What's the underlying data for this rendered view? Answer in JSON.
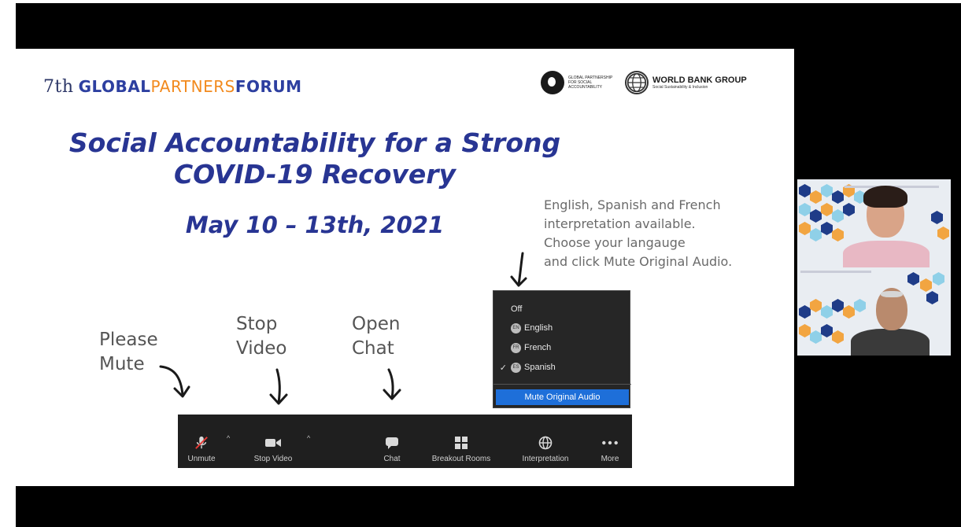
{
  "slide": {
    "forum_logo": {
      "number": "7th",
      "global": "GLOBAL",
      "partners": "PARTNERS",
      "forum": "FORUM"
    },
    "partner_logos": {
      "gpsa_text": "Global Partnership for Social Accountability",
      "wbg_name": "WORLD BANK GROUP",
      "wbg_sub": "Social Sustainability & Inclusion"
    },
    "title_line1": "Social Accountability for a Strong",
    "title_line2": "COVID-19 Recovery",
    "date": "May 10 – 13th, 2021",
    "note": {
      "line1": "English, Spanish and French",
      "line2": "interpretation available.",
      "line3": "Choose your langauge",
      "line4": "and click Mute Original Audio."
    },
    "hints": {
      "mute_line1": "Please",
      "mute_line2": "Mute",
      "video_line1": "Stop",
      "video_line2": "Video",
      "chat_line1": "Open",
      "chat_line2": "Chat"
    }
  },
  "interpretation_menu": {
    "off": "Off",
    "options": [
      {
        "code": "EN",
        "label": "English",
        "checked": false
      },
      {
        "code": "FR",
        "label": "French",
        "checked": false
      },
      {
        "code": "ES",
        "label": "Spanish",
        "checked": true
      }
    ],
    "mute_original": "Mute Original Audio"
  },
  "toolbar": {
    "unmute": "Unmute",
    "stop_video": "Stop Video",
    "chat": "Chat",
    "breakout_rooms": "Breakout Rooms",
    "interpretation": "Interpretation",
    "more": "More"
  },
  "colors": {
    "title_blue": "#283593",
    "partners_orange": "#f28a1e",
    "toolbar_bg": "#1f1f1f",
    "highlight_blue": "#1e6fd9"
  }
}
